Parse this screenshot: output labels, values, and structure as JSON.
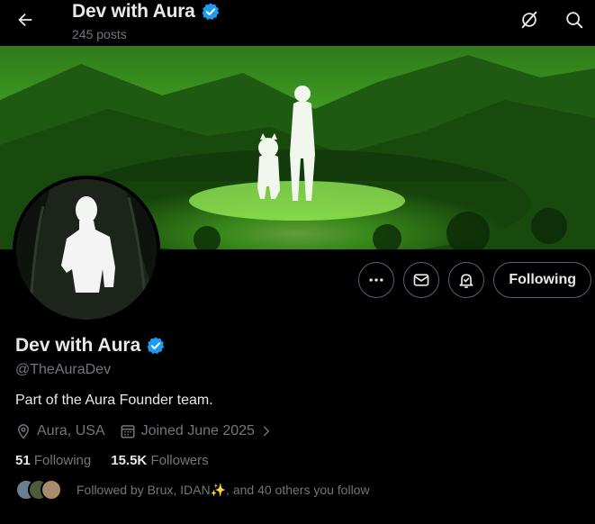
{
  "header": {
    "title": "Dev with Aura",
    "posts_count": "245 posts"
  },
  "icons": {
    "back": "back-arrow-icon",
    "grok": "grok-icon",
    "search": "search-icon",
    "more": "more-icon",
    "message": "mail-icon",
    "notify": "bell-icon",
    "verified": "verified-badge-icon"
  },
  "profile": {
    "display_name": "Dev with Aura",
    "handle": "@TheAuraDev",
    "bio": "Part of the Aura Founder team.",
    "location": "Aura, USA",
    "joined": "Joined June 2025",
    "following_count": "51",
    "following_label": "Following",
    "followers_count": "15.5K",
    "followers_label": "Followers",
    "followed_by": "Followed by Brux, IDAN✨, and 40 others you follow"
  },
  "actions": {
    "follow_label": "Following"
  },
  "colors": {
    "verified": "#1d9bf0",
    "muted": "#71767b",
    "banner_glow": "#7cff3a"
  }
}
